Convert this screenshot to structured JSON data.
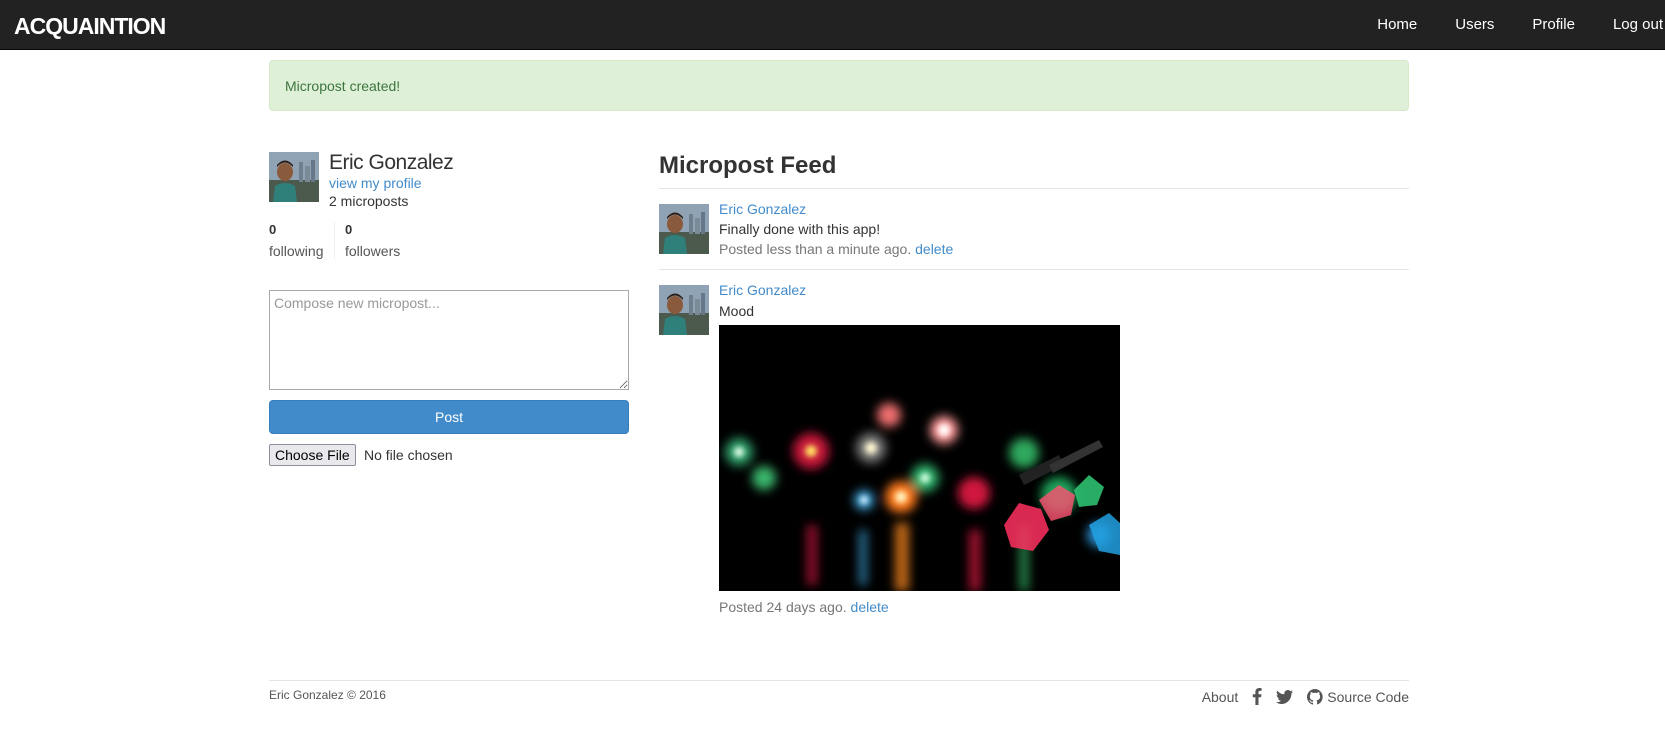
{
  "navbar": {
    "brand": "ACQUAINTION",
    "links": [
      "Home",
      "Users",
      "Profile",
      "Log out"
    ]
  },
  "flash": {
    "message": "Micropost created!"
  },
  "sidebar": {
    "user_name": "Eric Gonzalez",
    "view_profile": "view my profile",
    "micropost_count": "2 microposts",
    "stats": {
      "following": {
        "count": "0",
        "label": "following"
      },
      "followers": {
        "count": "0",
        "label": "followers"
      }
    },
    "compose": {
      "placeholder": "Compose new micropost...",
      "value": ""
    },
    "post_button": "Post",
    "file_button": "Choose File",
    "file_status": "No file chosen"
  },
  "feed": {
    "title": "Micropost Feed",
    "posts": [
      {
        "user": "Eric Gonzalez",
        "content": "Finally done with this app!",
        "timestamp": "Posted less than a minute ago.",
        "delete_label": "delete"
      },
      {
        "user": "Eric Gonzalez",
        "content": "Mood",
        "has_image": true,
        "timestamp": "Posted 24 days ago.",
        "delete_label": "delete"
      }
    ]
  },
  "footer": {
    "copyright": "Eric Gonzalez © 2016",
    "about": "About",
    "icons": [
      "facebook-icon",
      "twitter-icon",
      "github-icon"
    ],
    "source_code": "Source Code"
  },
  "colors": {
    "navbar_bg": "#222222",
    "link": "#428bca",
    "success_bg": "#dff0d8",
    "success_text": "#3c763d",
    "primary_button": "#428bca"
  }
}
